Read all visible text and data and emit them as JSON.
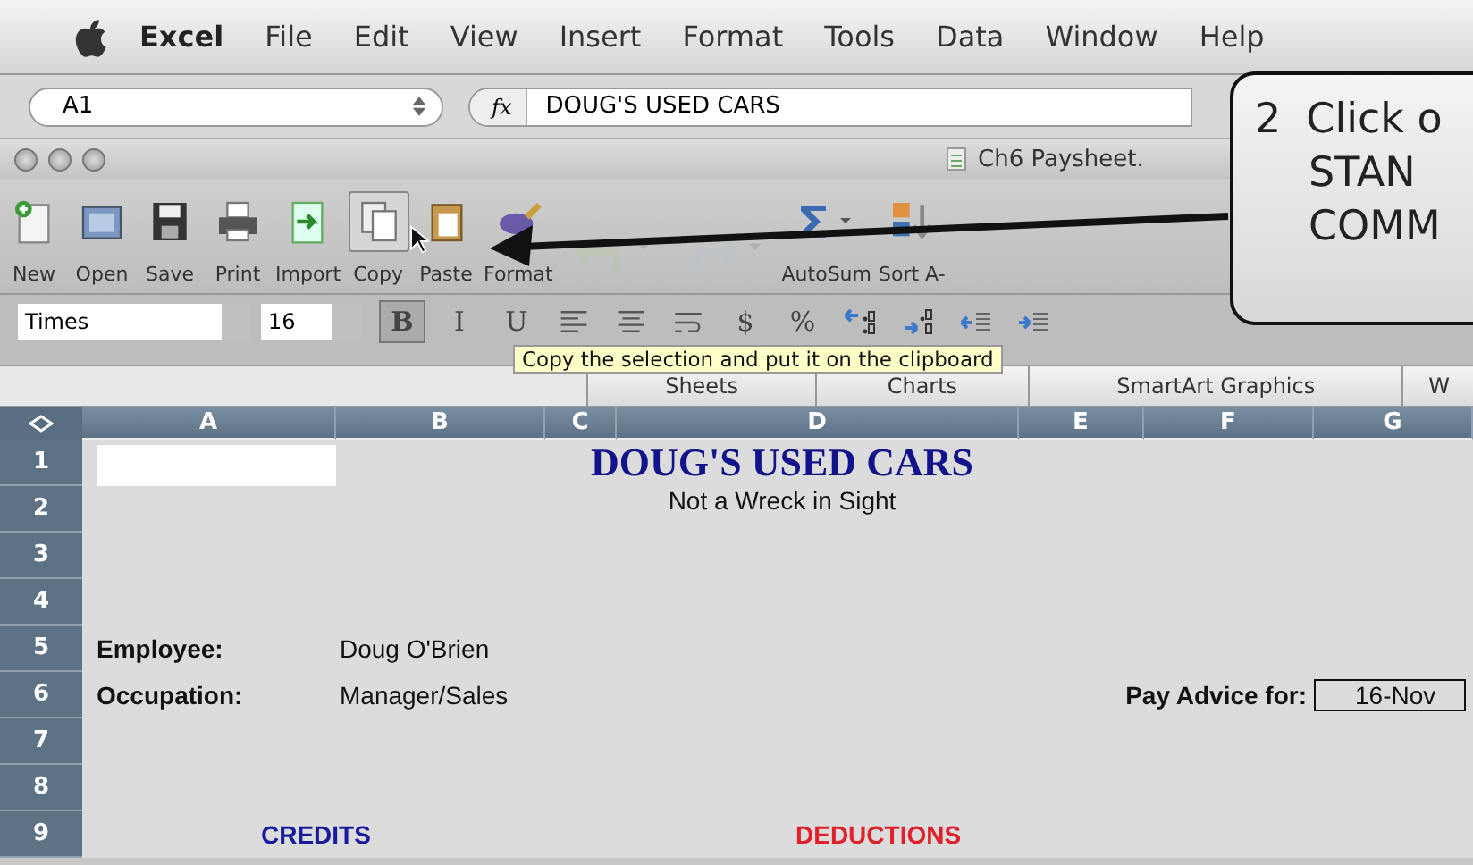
{
  "menu_bar": {
    "items": [
      {
        "label": "Excel",
        "kind": "app"
      },
      {
        "label": "File",
        "kind": "menu"
      },
      {
        "label": "Edit",
        "kind": "menu"
      },
      {
        "label": "View",
        "kind": "menu"
      },
      {
        "label": "Insert",
        "kind": "menu"
      },
      {
        "label": "Format",
        "kind": "menu"
      },
      {
        "label": "Tools",
        "kind": "menu"
      },
      {
        "label": "Data",
        "kind": "menu"
      },
      {
        "label": "Window",
        "kind": "menu"
      },
      {
        "label": "Help",
        "kind": "menu"
      }
    ]
  },
  "formula_bar": {
    "name_box": "A1",
    "fx": "fx",
    "value": "DOUG'S USED CARS"
  },
  "window": {
    "title": "Ch6 Paysheet."
  },
  "toolbar": {
    "buttons": [
      {
        "label": "New",
        "kind": "new",
        "disabled": false,
        "pressed": false
      },
      {
        "label": "Open",
        "kind": "open",
        "disabled": false,
        "pressed": false
      },
      {
        "label": "Save",
        "kind": "save",
        "disabled": false,
        "pressed": false
      },
      {
        "label": "Print",
        "kind": "print",
        "disabled": false,
        "pressed": false
      },
      {
        "label": "Import",
        "kind": "import",
        "disabled": false,
        "pressed": false
      },
      {
        "label": "Copy",
        "kind": "copy",
        "disabled": false,
        "pressed": true
      },
      {
        "label": "Paste",
        "kind": "paste",
        "disabled": false,
        "pressed": false
      },
      {
        "label": "Format",
        "kind": "format",
        "disabled": false,
        "pressed": false
      },
      {
        "kind": "undo",
        "disabled": true,
        "pressed": false
      },
      {
        "kind": "redo",
        "disabled": true,
        "pressed": false
      },
      {
        "label": "AutoSum",
        "kind": "sum",
        "disabled": false,
        "pressed": false
      },
      {
        "label": "Sort A-",
        "kind": "sort",
        "disabled": false,
        "pressed": false
      }
    ]
  },
  "format_bar": {
    "font": "Times",
    "size": "16",
    "buttons": [
      {
        "label": "B",
        "kind": "bold",
        "on": true
      },
      {
        "label": "I",
        "kind": "italic",
        "on": false
      },
      {
        "label": "U",
        "kind": "underline",
        "on": false
      },
      {
        "kind": "align-left",
        "on": false
      },
      {
        "kind": "align-center",
        "on": false
      },
      {
        "kind": "wrap",
        "on": false
      },
      {
        "label": "$",
        "kind": "currency",
        "on": false
      },
      {
        "label": "%",
        "kind": "percent",
        "on": false
      },
      {
        "kind": "more-decimals",
        "on": false
      },
      {
        "kind": "fewer-decimals",
        "on": false
      },
      {
        "kind": "outdent",
        "on": false
      },
      {
        "kind": "indent",
        "on": false
      }
    ]
  },
  "tooltip": "Copy the selection and put it on the clipboard",
  "gallery_tabs": [
    {
      "label": "Sheets",
      "selected": false
    },
    {
      "label": "Charts",
      "selected": false
    },
    {
      "label": "SmartArt Graphics",
      "selected": false
    },
    {
      "label": "W",
      "selected": false
    }
  ],
  "sheet": {
    "columns": [
      "A",
      "B",
      "C",
      "D",
      "E",
      "F",
      "G"
    ],
    "rows": [
      {
        "label": "1",
        "cells": [
          {
            "kind": "selected"
          },
          {},
          {
            "kind": "title",
            "text": "DOUG'S USED CARS"
          }
        ]
      },
      {
        "label": "2",
        "cells": [
          {},
          {},
          {
            "kind": "subtitle",
            "text": "Not a Wreck in Sight"
          }
        ]
      },
      {
        "label": "3",
        "cells": []
      },
      {
        "label": "4",
        "cells": []
      },
      {
        "label": "5",
        "cells": [
          {
            "kind": "label",
            "text": "Employee:"
          },
          {
            "kind": "value",
            "text": "Doug O'Brien"
          }
        ]
      },
      {
        "label": "6",
        "cells": [
          {
            "kind": "label",
            "text": "Occupation:"
          },
          {
            "kind": "value",
            "text": "Manager/Sales"
          },
          {},
          {},
          {},
          {
            "kind": "caption",
            "text": "Pay Advice for:"
          },
          {
            "kind": "boxed",
            "text": "16-Nov"
          }
        ]
      },
      {
        "label": "7",
        "cells": []
      },
      {
        "label": "8",
        "cells": []
      },
      {
        "label": "9",
        "cells": [
          {
            "kind": "heading",
            "text": "CREDITS",
            "color": "#1a1aa0"
          },
          {},
          {},
          {
            "kind": "heading",
            "text": "DEDUCTIONS",
            "color": "#e0202a"
          }
        ]
      }
    ]
  },
  "callout": {
    "number": "2",
    "lines": [
      "Click o",
      "STAN",
      "COMM"
    ]
  }
}
